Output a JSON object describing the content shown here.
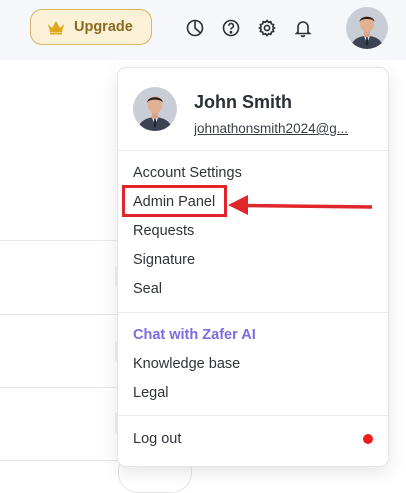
{
  "header": {
    "upgrade_label": "Upgrade",
    "icons": [
      "pie-chart-icon",
      "help-icon",
      "settings-icon",
      "bell-icon"
    ]
  },
  "user": {
    "name": "John Smith",
    "email": "johnathonsmith2024@g..."
  },
  "menu": {
    "items": [
      {
        "label": "Account Settings"
      },
      {
        "label": "Admin Panel"
      },
      {
        "label": "Requests"
      },
      {
        "label": "Signature"
      },
      {
        "label": "Seal"
      }
    ],
    "secondary": [
      {
        "label": "Chat with Zafer AI"
      },
      {
        "label": "Knowledge base"
      },
      {
        "label": "Legal"
      }
    ],
    "logout_label": "Log out"
  },
  "colors": {
    "accent_ai": "#7b6ae0",
    "upgrade_bg": "#fbf1d6",
    "upgrade_border": "#d6b46a",
    "highlight": "#e0262b",
    "notification_dot": "#ef1c1c"
  }
}
